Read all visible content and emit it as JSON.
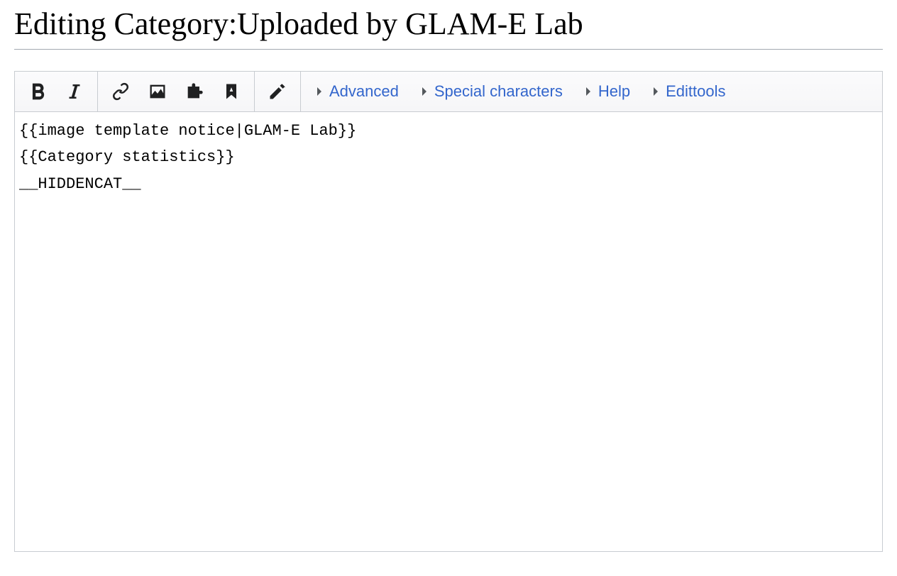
{
  "page": {
    "title": "Editing Category:Uploaded by GLAM-E Lab"
  },
  "toolbar": {
    "links": {
      "advanced": "Advanced",
      "special": "Special characters",
      "help": "Help",
      "edittools": "Edittools"
    }
  },
  "editor": {
    "content": "{{image template notice|GLAM-E Lab}}\n{{Category statistics}}\n__HIDDENCAT__"
  }
}
